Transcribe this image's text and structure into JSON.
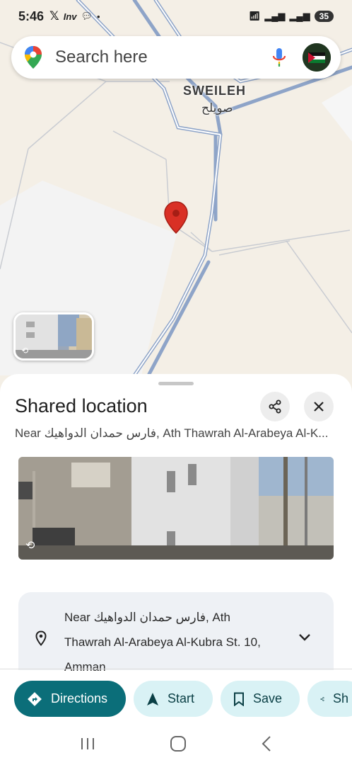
{
  "status_bar": {
    "time": "5:46",
    "left_icons": [
      "x-logo-icon",
      "inv-icon",
      "chat-bubble-icon",
      "dot-icon"
    ],
    "inv_label": "Inv",
    "battery": "35"
  },
  "search": {
    "placeholder": "Search here"
  },
  "map": {
    "label_en": "SWEILEH",
    "label_ar": "صويلح"
  },
  "sheet": {
    "title": "Shared location",
    "subtitle": "Near فارس حمدان الدواهيك, Ath Thawrah Al-Arabeya Al-K...",
    "address_lines": [
      "Near فارس حمدان الدواهيك, Ath",
      "Thawrah Al-Arabeya Al-Kubra St. 10,",
      "Amman"
    ]
  },
  "actions": {
    "directions": "Directions",
    "start": "Start",
    "save": "Save",
    "share": "Sh"
  },
  "colors": {
    "primary": "#0b6e79",
    "secondary": "#d9f2f5",
    "road": "#8ea4c8",
    "pin": "#d93025"
  }
}
